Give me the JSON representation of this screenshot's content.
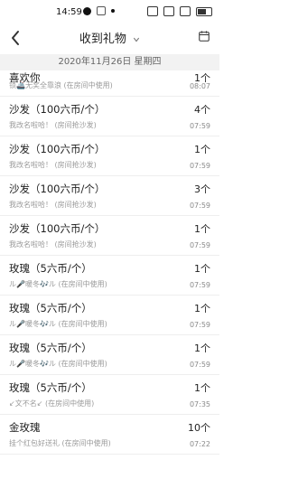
{
  "status_bar": {
    "time": "14:59",
    "left_icons": [
      "x-circle-icon",
      "app-icon",
      "dot-icon"
    ],
    "right_icons": [
      "do-not-disturb-icon",
      "wifi-icon",
      "sim-icon",
      "battery-icon"
    ]
  },
  "header": {
    "back_icon": "chevron-left-icon",
    "title": "收到礼物",
    "title_dropdown_icon": "chevron-down-icon",
    "calendar_icon": "calendar-icon"
  },
  "date_bar": {
    "text": "2020年11月26日 星期四"
  },
  "gifts": [
    {
      "name": "喜欢你",
      "sub": "锁🚢无奖全靠浪 (在房间中使用)",
      "count": "1个",
      "time": "08:07"
    },
    {
      "name": "沙发（100六币/个）",
      "sub": "我改名啦哈！ (房间抢沙发)",
      "count": "4个",
      "time": "07:59"
    },
    {
      "name": "沙发（100六币/个）",
      "sub": "我改名啦哈！ (房间抢沙发)",
      "count": "1个",
      "time": "07:59"
    },
    {
      "name": "沙发（100六币/个）",
      "sub": "我改名啦哈！ (房间抢沙发)",
      "count": "3个",
      "time": "07:59"
    },
    {
      "name": "沙发（100六币/个）",
      "sub": "我改名啦哈！ (房间抢沙发)",
      "count": "1个",
      "time": "07:59"
    },
    {
      "name": "玫瑰（5六币/个）",
      "sub": "ル🎤暖冬🎶ル (在房间中使用)",
      "count": "1个",
      "time": "07:59"
    },
    {
      "name": "玫瑰（5六币/个）",
      "sub": "ル🎤暖冬🎶ル (在房间中使用)",
      "count": "1个",
      "time": "07:59"
    },
    {
      "name": "玫瑰（5六币/个）",
      "sub": "ル🎤暖冬🎶ル (在房间中使用)",
      "count": "1个",
      "time": "07:59"
    },
    {
      "name": "玫瑰（5六币/个）",
      "sub": "↙文不名↙ (在房间中使用)",
      "count": "1个",
      "time": "07:35"
    },
    {
      "name": "金玫瑰",
      "sub": "挂个红包好送礼 (在房间中使用)",
      "count": "10个",
      "time": "07:22"
    }
  ]
}
